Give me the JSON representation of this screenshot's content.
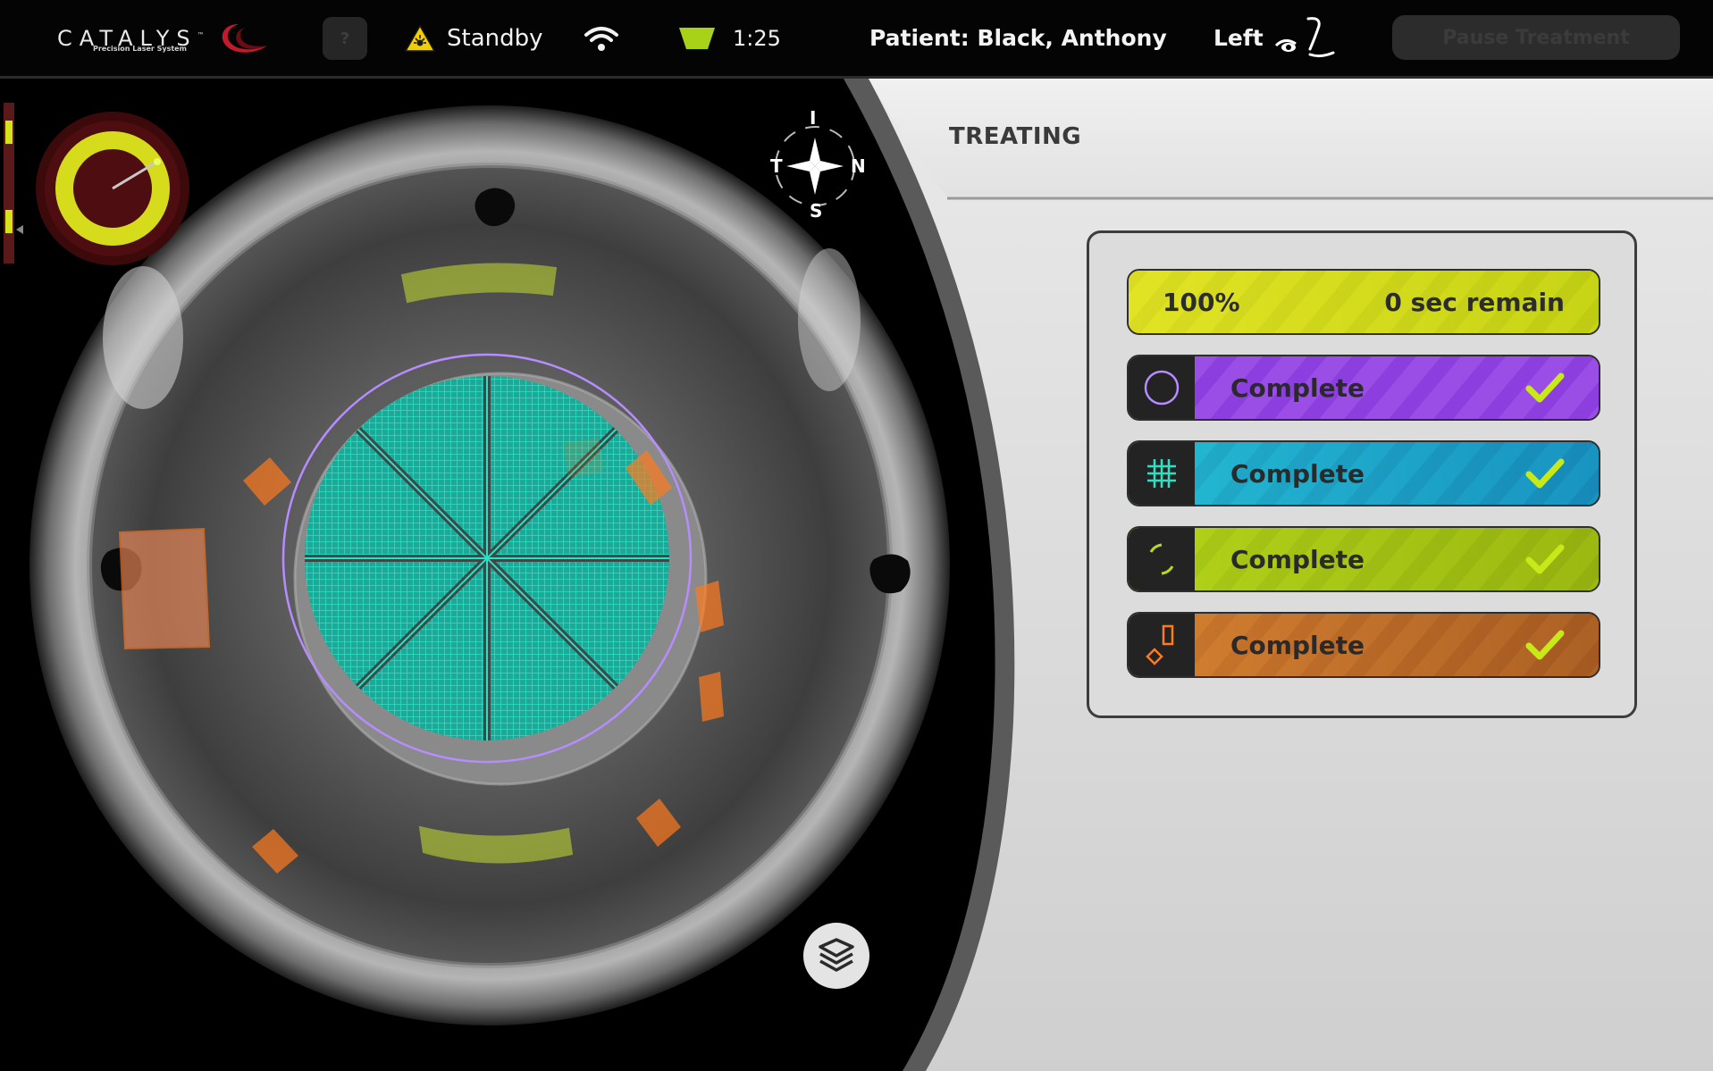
{
  "header": {
    "logo_text": "CATALYS",
    "logo_tm": "™",
    "logo_subtitle": "Precision Laser System",
    "help_label": "?",
    "standby_label": "Standby",
    "timer": "1:25",
    "patient": "Patient: Black, Anthony",
    "eye_side": "Left",
    "pause_label": "Pause Treatment"
  },
  "compass": {
    "top": "I",
    "left": "T",
    "right": "N",
    "bottom": "S"
  },
  "panel": {
    "title": "TREATING",
    "progress": {
      "percent_label": "100%",
      "remaining_label": "0 sec remain",
      "value": 1.0
    },
    "steps": [
      {
        "name": "capsulotomy",
        "label": "Complete",
        "icon": "circle-icon",
        "color": "#9a4ee6"
      },
      {
        "name": "fragmentation",
        "label": "Complete",
        "icon": "grid-icon",
        "color": "#1ca3c8"
      },
      {
        "name": "arcuate",
        "label": "Complete",
        "icon": "arc-icon",
        "color": "#a8c814"
      },
      {
        "name": "incision",
        "label": "Complete",
        "icon": "incision-icon",
        "color": "#c7742a"
      }
    ]
  },
  "colors": {
    "accent_yellow": "#d6e21c",
    "capsulotomy_ring": "#b68cff",
    "fragmentation_grid": "#22cfb5",
    "arcuate_overlay": "#c8e030",
    "incision_overlay": "#ff7a1e"
  }
}
